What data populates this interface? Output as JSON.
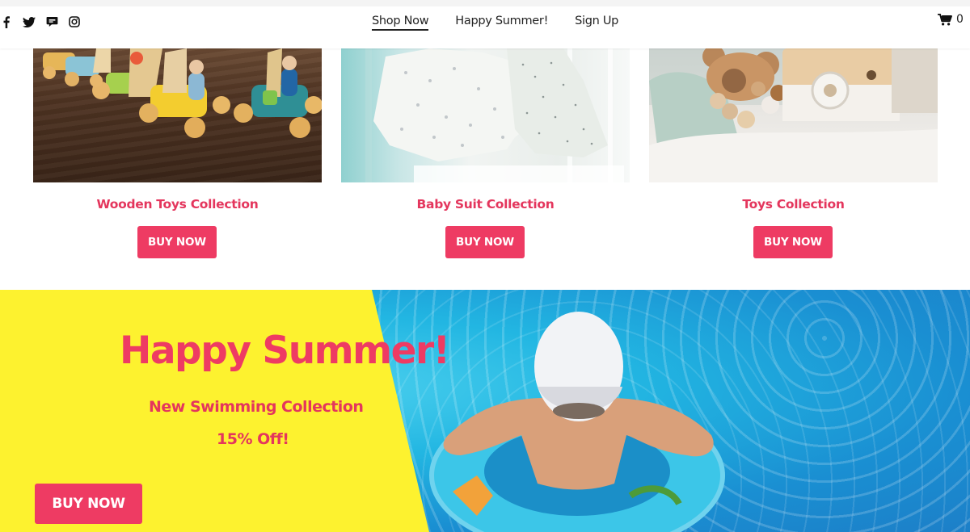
{
  "header": {
    "social_icons": [
      "facebook-icon",
      "twitter-icon",
      "chat-icon",
      "instagram-icon"
    ],
    "nav": [
      {
        "label": "Shop Now",
        "active": true
      },
      {
        "label": "Happy Summer!",
        "active": false
      },
      {
        "label": "Sign Up",
        "active": false
      }
    ],
    "cart": {
      "icon": "cart-icon",
      "count": "0"
    }
  },
  "products": [
    {
      "title": "Wooden Toys Collection",
      "button": "BUY NOW",
      "image": "wooden-toy-boats-photo"
    },
    {
      "title": "Baby Suit Collection",
      "button": "BUY NOW",
      "image": "baby-suits-on-hangers-photo"
    },
    {
      "title": "Toys Collection",
      "button": "BUY NOW",
      "image": "wooden-teethers-and-toy-camera-photo"
    }
  ],
  "banner": {
    "title": "Happy Summer!",
    "subtitle": "New Swimming Collection",
    "offer": "15% Off!",
    "button": "BUY NOW",
    "image": "child-swimming-with-float-ring-photo"
  },
  "colors": {
    "accent": "#ee3b63",
    "title_pink": "#e4365d",
    "banner_yellow": "#fdf22f",
    "pool_blue": "#22b6e2",
    "text_dark": "#222222"
  }
}
